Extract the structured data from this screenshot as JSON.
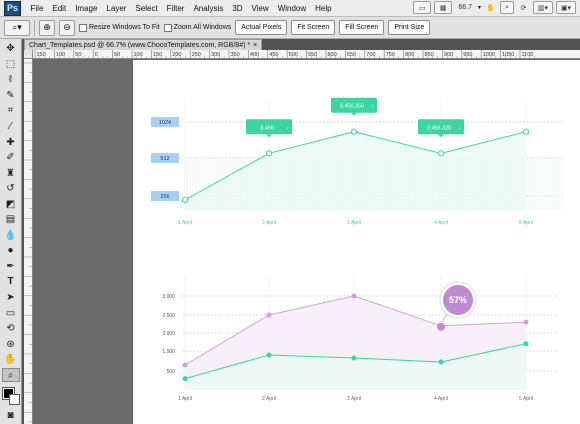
{
  "app": {
    "logo": "Ps"
  },
  "menu": [
    "File",
    "Edit",
    "Image",
    "Layer",
    "Select",
    "Filter",
    "Analysis",
    "3D",
    "View",
    "Window",
    "Help"
  ],
  "menubar_right": {
    "zoom": "66.7",
    "icons": [
      "mini-bridge-icon",
      "ruler-icon",
      "zoom-dropdown-icon",
      "hand-icon",
      "zoom-icon",
      "rotate-icon",
      "arrange-icon",
      "screen-mode-icon"
    ]
  },
  "options": {
    "resize_windows": "Resize Windows To Fit",
    "zoom_all": "Zoom All Windows",
    "actual_pixels": "Actual Pixels",
    "fit_screen": "Fit Screen",
    "fill_screen": "Fill Screen",
    "print_size": "Print Size"
  },
  "doc_tab": "Chart_Templates.psd @ 66.7% (www.ChocoTemplates.com, RGB/8#) *",
  "doc_tab_close": "×",
  "ruler_top": [
    "150",
    "100",
    "50",
    "0",
    "50",
    "100",
    "150",
    "200",
    "250",
    "300",
    "350",
    "400",
    "450",
    "500",
    "550",
    "600",
    "650",
    "700",
    "750",
    "800",
    "850",
    "900",
    "950",
    "1000",
    "1050",
    "1100"
  ],
  "tools": [
    "move-tool-icon",
    "marquee-tool-icon",
    "lasso-tool-icon",
    "quick-select-tool-icon",
    "crop-tool-icon",
    "eyedropper-tool-icon",
    "spot-healing-tool-icon",
    "brush-tool-icon",
    "clone-stamp-tool-icon",
    "history-brush-tool-icon",
    "eraser-tool-icon",
    "gradient-tool-icon",
    "blur-tool-icon",
    "dodge-tool-icon",
    "pen-tool-icon",
    "type-tool-icon",
    "path-select-tool-icon",
    "shape-tool-icon",
    "3d-rotate-tool-icon",
    "3d-orbit-tool-icon",
    "hand-tool-icon",
    "zoom-tool-icon"
  ],
  "colors": {
    "teal": "#3dd4a2",
    "teal_fill": "#eafaf4",
    "blue_label": "#a6d1f6",
    "pink": "#cfa3d6",
    "pink_fill": "#f7eef8",
    "badge": "#c08ad0"
  },
  "chart_data": [
    {
      "type": "line",
      "categories": [
        "1 April",
        "2 April",
        "3 April",
        "4 April",
        "5 April"
      ],
      "y_ticks": [
        "1024",
        "512",
        "256"
      ],
      "values": [
        45,
        252,
        348,
        252,
        348
      ],
      "callouts": [
        {
          "text": "3.456",
          "at": 1
        },
        {
          "text": "3.456.350",
          "at": 2
        },
        {
          "text": "2.456.320",
          "at": 3
        }
      ]
    },
    {
      "type": "area",
      "categories": [
        "1 April",
        "2 April",
        "3 April",
        "4 April",
        "5 April"
      ],
      "y_ticks": [
        "3.000",
        "2.500",
        "2.000",
        "1.500",
        "500"
      ],
      "series": [
        {
          "values": [
            800,
            2500,
            3000,
            2200,
            2300
          ]
        },
        {
          "values": [
            300,
            1300,
            1150,
            950,
            1700
          ]
        }
      ],
      "badge": "57%"
    }
  ]
}
